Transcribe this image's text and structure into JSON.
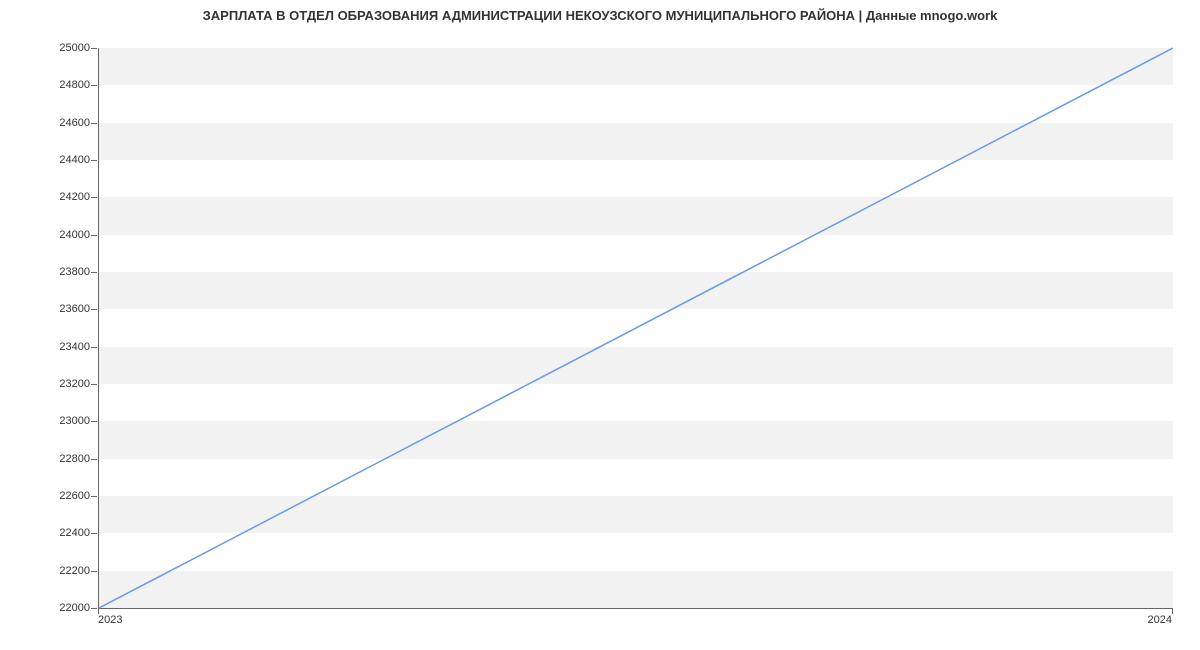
{
  "chart_data": {
    "type": "line",
    "title": "ЗАРПЛАТА В ОТДЕЛ ОБРАЗОВАНИЯ АДМИНИСТРАЦИИ НЕКОУЗСКОГО МУНИЦИПАЛЬНОГО РАЙОНА | Данные mnogo.work",
    "x": [
      "2023",
      "2024"
    ],
    "values": [
      22000,
      25000
    ],
    "xlabel": "",
    "ylabel": "",
    "ylim": [
      22000,
      25000
    ],
    "yticks": [
      22000,
      22200,
      22400,
      22600,
      22800,
      23000,
      23200,
      23400,
      23600,
      23800,
      24000,
      24200,
      24400,
      24600,
      24800,
      25000
    ],
    "line_color": "#6699e8"
  }
}
